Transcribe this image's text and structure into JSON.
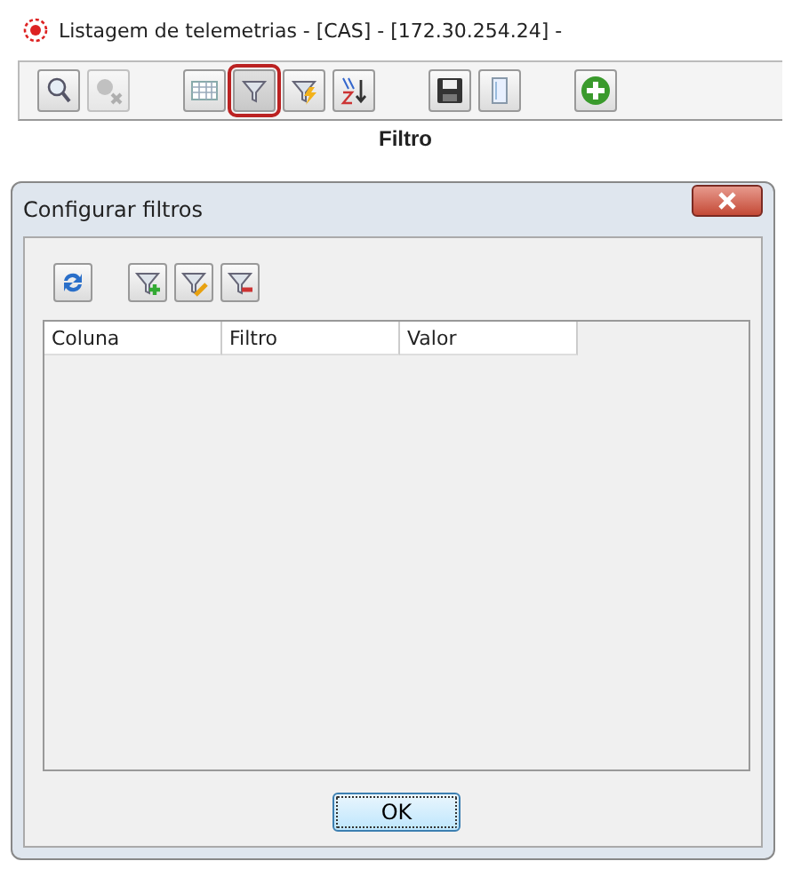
{
  "window": {
    "title": "Listagem de telemetrias - [CAS] - [172.30.254.24] -"
  },
  "toolbar": [
    {
      "kind": "search",
      "selected": false,
      "disabled": false
    },
    {
      "kind": "search-clear",
      "selected": false,
      "disabled": true
    },
    {
      "kind": "grid",
      "selected": false,
      "disabled": false
    },
    {
      "kind": "filter",
      "selected": true,
      "disabled": false
    },
    {
      "kind": "filter-lightning",
      "selected": false,
      "disabled": false
    },
    {
      "kind": "sort",
      "selected": false,
      "disabled": false
    },
    {
      "kind": "save",
      "selected": false,
      "disabled": false
    },
    {
      "kind": "page",
      "selected": false,
      "disabled": false
    },
    {
      "kind": "add",
      "selected": false,
      "disabled": false
    }
  ],
  "tooltip": "Filtro",
  "dialog": {
    "title": "Configurar filtros",
    "toolbar": [
      {
        "kind": "refresh"
      },
      {
        "kind": "filter-add"
      },
      {
        "kind": "filter-edit"
      },
      {
        "kind": "filter-remove"
      }
    ],
    "table": {
      "columns": [
        "Coluna",
        "Filtro",
        "Valor"
      ]
    },
    "buttons": [
      "OK"
    ]
  }
}
